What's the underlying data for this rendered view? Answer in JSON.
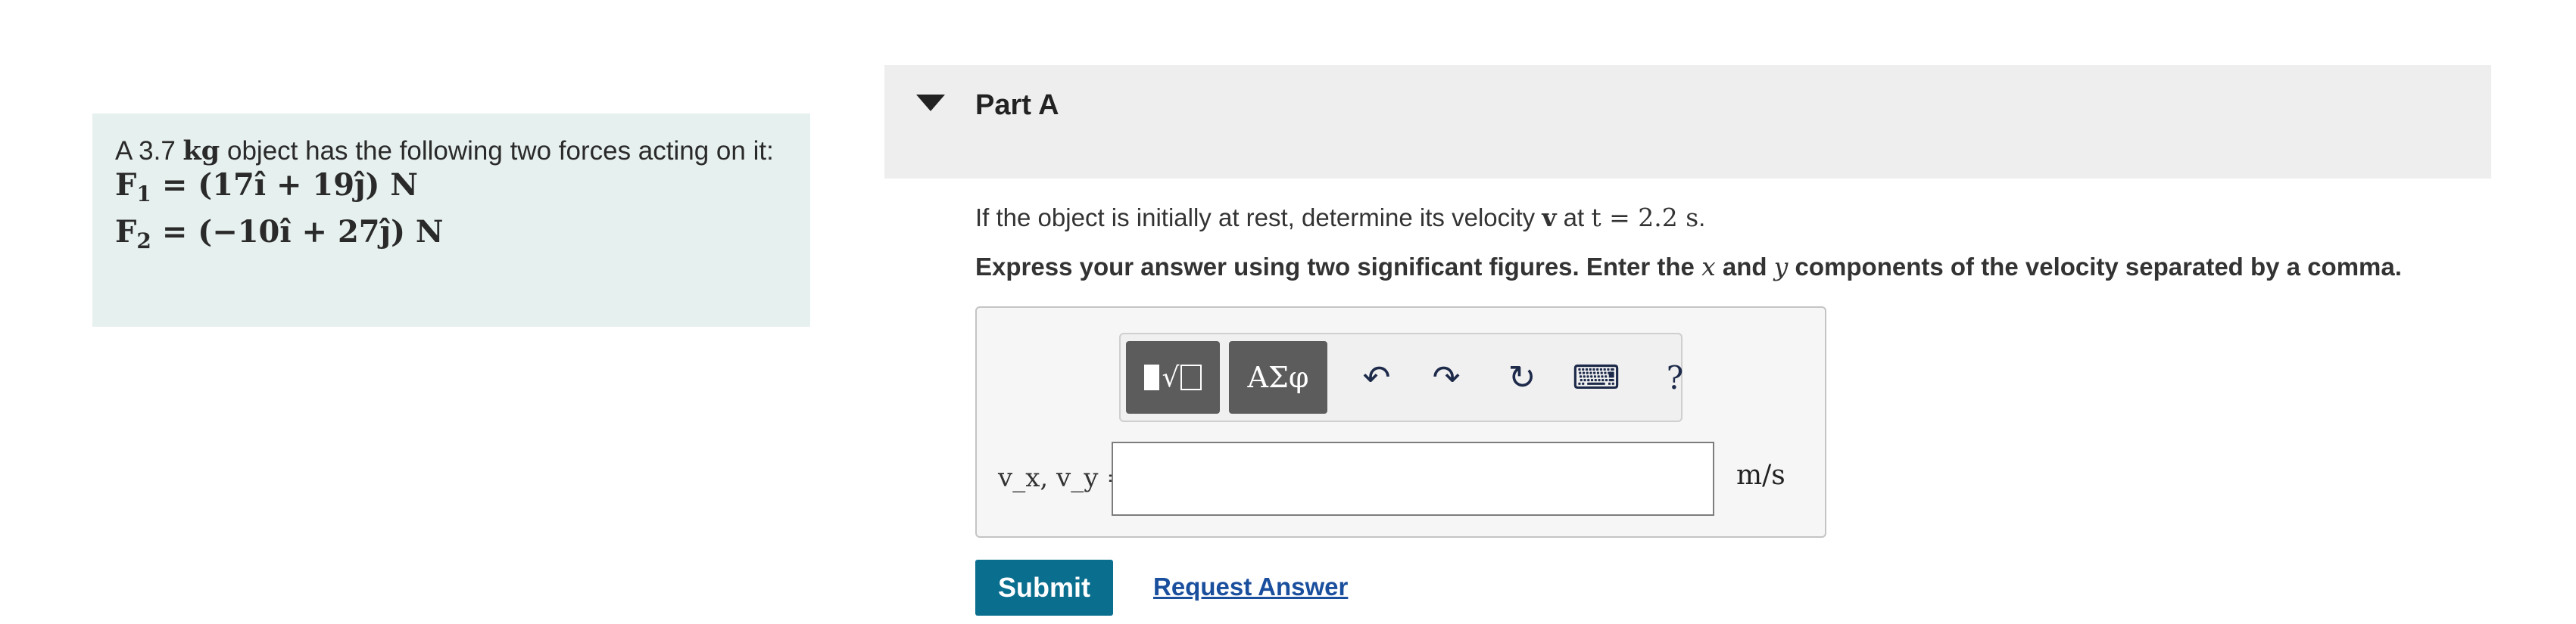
{
  "problem": {
    "intro_a": "A 3.7",
    "intro_unit": "kg",
    "intro_b": "object has the following two forces acting on it:",
    "force1": {
      "label": "F",
      "sub": "1",
      "expr": "= (17î + 19ĵ) N"
    },
    "force2": {
      "label": "F",
      "sub": "2",
      "expr": "= (−10î + 27ĵ) N"
    }
  },
  "part": {
    "title": "Part A",
    "question_a": "If the object is initially at rest, determine its velocity",
    "question_vec": "v",
    "question_b": "at",
    "question_t": "t = 2.2 s",
    "question_end": ".",
    "instruction_a": "Express your answer using two significant figures. Enter the",
    "instruction_x": "x",
    "instruction_and": "and",
    "instruction_y": "y",
    "instruction_b": "components of the velocity separated by a comma."
  },
  "toolbar": {
    "symbols_label": "ΑΣφ",
    "undo_glyph": "↶",
    "redo_glyph": "↷",
    "reset_glyph": "↻",
    "keyboard_glyph": "⌨",
    "help_glyph": "?"
  },
  "answer": {
    "label": "v_x, v_y =",
    "value": "",
    "unit": "m/s"
  },
  "actions": {
    "submit_label": "Submit",
    "request_label": "Request Answer"
  },
  "colors": {
    "problem_bg": "#e6f0ee",
    "submit_bg": "#0a6e8f",
    "link": "#1a4f9e",
    "toolbar_button": "#5c5c5c"
  }
}
